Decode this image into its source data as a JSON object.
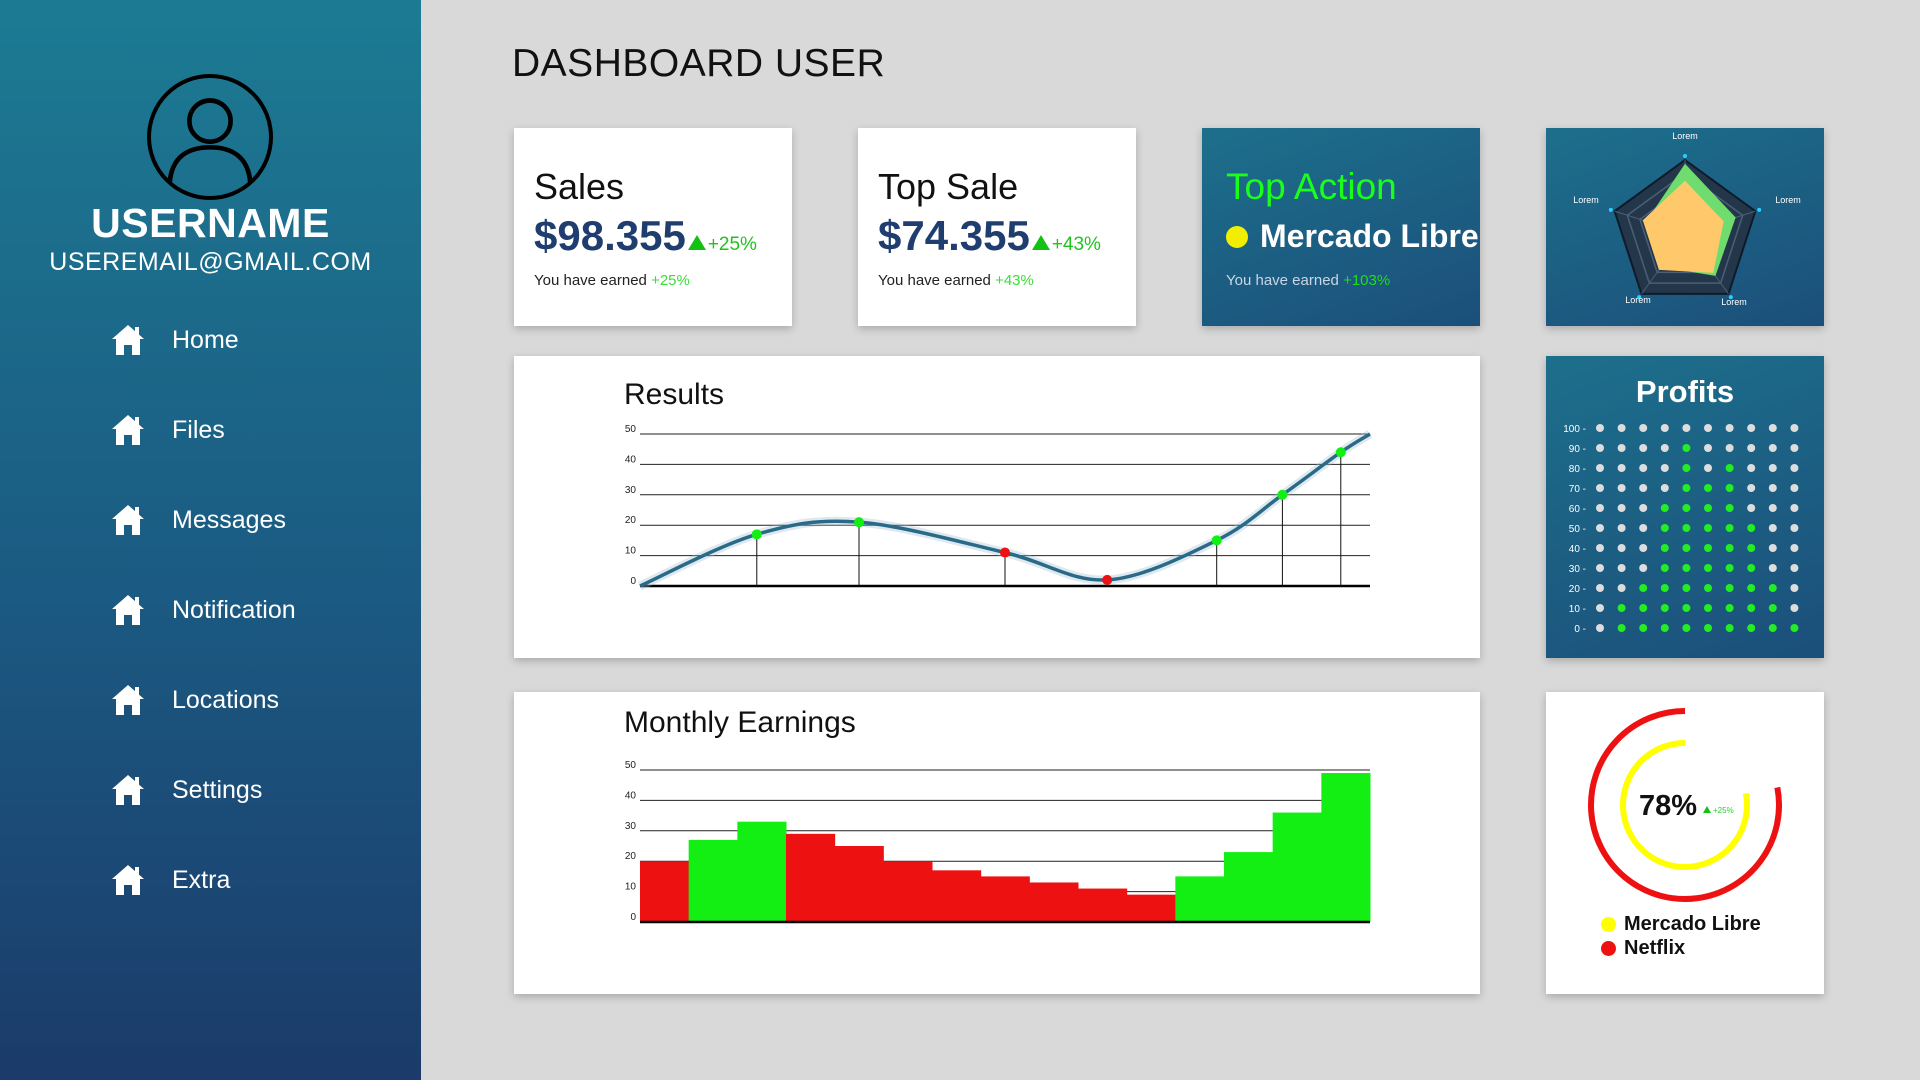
{
  "sidebar": {
    "username": "USERNAME",
    "email": "USEREMAIL@GMAIL.COM",
    "items": [
      {
        "label": "Home",
        "icon": "home-icon"
      },
      {
        "label": "Files",
        "icon": "home-icon"
      },
      {
        "label": "Messages",
        "icon": "home-icon"
      },
      {
        "label": "Notification",
        "icon": "home-icon"
      },
      {
        "label": "Locations",
        "icon": "home-icon"
      },
      {
        "label": "Settings",
        "icon": "home-icon"
      },
      {
        "label": "Extra",
        "icon": "home-icon"
      }
    ]
  },
  "header": {
    "title": "DASHBOARD USER"
  },
  "cards": {
    "sales": {
      "title": "Sales",
      "value": "$98.355",
      "delta": "+25%",
      "note": "You have earned ",
      "note_pct": "+25%"
    },
    "top_sale": {
      "title": "Top Sale",
      "value": "$74.355",
      "delta": "+43%",
      "note": "You have earned ",
      "note_pct": "+43%"
    },
    "top_action": {
      "title": "Top Action",
      "company": "Mercado Libre",
      "note": "You have earned ",
      "note_pct": "+103%"
    },
    "radar": {
      "labels": [
        "Lorem",
        "Lorem",
        "Lorem",
        "Lorem",
        "Lorem"
      ]
    },
    "profits": {
      "title": "Profits"
    },
    "gauge": {
      "percent_label": "78%",
      "delta": "+25%",
      "legend": [
        {
          "label": "Mercado Libre",
          "color": "#ffff00"
        },
        {
          "label": "Netflix",
          "color": "#ee1111"
        }
      ]
    }
  },
  "chart_data": [
    {
      "type": "line",
      "title": "Results",
      "ylim": [
        0,
        50
      ],
      "yticks": [
        "0",
        "10",
        "20",
        "30",
        "40",
        "50"
      ],
      "x": [
        0,
        1.6,
        3.0,
        5.0,
        6.4,
        7.9,
        8.8,
        9.6,
        10
      ],
      "y": [
        0,
        17,
        21,
        11,
        2,
        15,
        30,
        44,
        50
      ],
      "highlight_points": [
        {
          "x": 1.6,
          "y": 17,
          "color": "green"
        },
        {
          "x": 3.0,
          "y": 21,
          "color": "green"
        },
        {
          "x": 5.0,
          "y": 11,
          "color": "red"
        },
        {
          "x": 6.4,
          "y": 2,
          "color": "red"
        },
        {
          "x": 7.9,
          "y": 15,
          "color": "green"
        },
        {
          "x": 8.8,
          "y": 30,
          "color": "green"
        },
        {
          "x": 9.6,
          "y": 44,
          "color": "green"
        }
      ],
      "grid": true
    },
    {
      "type": "bar",
      "title": "Monthly Earnings",
      "ylim": [
        0,
        50
      ],
      "yticks": [
        "0",
        "10",
        "20",
        "30",
        "40",
        "50"
      ],
      "values": [
        20,
        27,
        33,
        29,
        25,
        20,
        17,
        15,
        13,
        11,
        9,
        15,
        23,
        36,
        49
      ],
      "colors": [
        "red",
        "green",
        "green",
        "red",
        "red",
        "red",
        "red",
        "red",
        "red",
        "red",
        "red",
        "green",
        "green",
        "green",
        "green"
      ],
      "grid": true
    },
    {
      "type": "radar",
      "axes": [
        "Lorem",
        "Lorem",
        "Lorem",
        "Lorem",
        "Lorem"
      ],
      "range": [
        0,
        1
      ],
      "series": [
        {
          "values": [
            0.95,
            0.72,
            0.7,
            0.55,
            0.55
          ],
          "color": "#6fdc6f"
        },
        {
          "values": [
            0.72,
            0.55,
            0.65,
            0.6,
            0.6
          ],
          "color": "#ffc86a"
        }
      ]
    },
    {
      "type": "heatmap",
      "title": "Profits",
      "yticks": [
        "100 -",
        "90 -",
        "80 -",
        "70 -",
        "60 -",
        "50 -",
        "40 -",
        "30 -",
        "20 -",
        "10 -",
        "0 -"
      ],
      "columns": 10,
      "green_from_row_index": [
        11,
        9,
        8,
        4,
        1,
        3,
        2,
        5,
        8,
        10
      ],
      "colors": {
        "on": "#22ee22",
        "off": "#dddddd"
      }
    },
    {
      "type": "pie",
      "series": [
        {
          "name": "Mercado Libre",
          "value": 0.78,
          "color": "#ffff00"
        },
        {
          "name": "Netflix",
          "value": 0.78,
          "color": "#ee1111"
        }
      ],
      "label": "78%"
    }
  ]
}
